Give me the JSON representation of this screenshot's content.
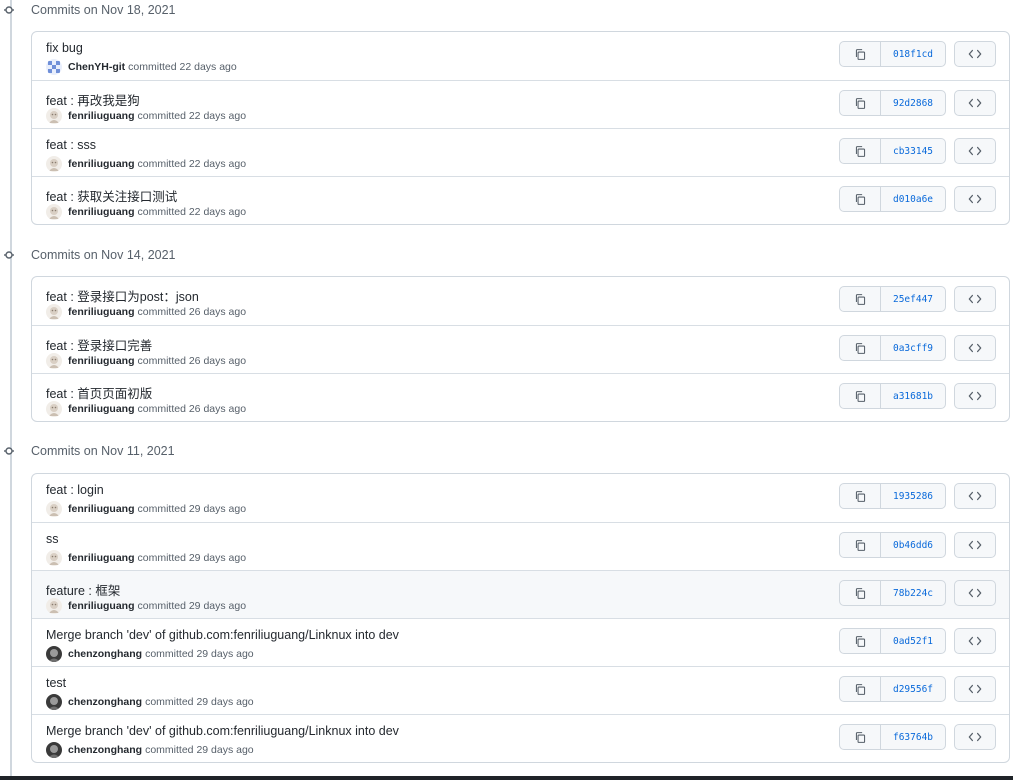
{
  "groups": [
    {
      "header": "Commits on Nov 18, 2021",
      "commits": [
        {
          "message": "fix bug",
          "author": "ChenYH-git",
          "time": "committed 22 days ago",
          "sha": "018f1cd",
          "avatar": "avatar-a"
        },
        {
          "message": "feat : 再改我是狗",
          "author": "fenriliuguang",
          "time": "committed 22 days ago",
          "sha": "92d2868",
          "avatar": "avatar-b"
        },
        {
          "message": "feat : sss",
          "author": "fenriliuguang",
          "time": "committed 22 days ago",
          "sha": "cb33145",
          "avatar": "avatar-b"
        },
        {
          "message": "feat : 获取关注接口测试",
          "author": "fenriliuguang",
          "time": "committed 22 days ago",
          "sha": "d010a6e",
          "avatar": "avatar-b"
        }
      ]
    },
    {
      "header": "Commits on Nov 14, 2021",
      "commits": [
        {
          "message": "feat : 登录接口为post：json",
          "author": "fenriliuguang",
          "time": "committed 26 days ago",
          "sha": "25ef447",
          "avatar": "avatar-b"
        },
        {
          "message": "feat : 登录接口完善",
          "author": "fenriliuguang",
          "time": "committed 26 days ago",
          "sha": "0a3cff9",
          "avatar": "avatar-b"
        },
        {
          "message": "feat : 首页页面初版",
          "author": "fenriliuguang",
          "time": "committed 26 days ago",
          "sha": "a31681b",
          "avatar": "avatar-b"
        }
      ]
    },
    {
      "header": "Commits on Nov 11, 2021",
      "commits": [
        {
          "message": "feat : login",
          "author": "fenriliuguang",
          "time": "committed 29 days ago",
          "sha": "1935286",
          "avatar": "avatar-b"
        },
        {
          "message": "ss",
          "author": "fenriliuguang",
          "time": "committed 29 days ago",
          "sha": "0b46dd6",
          "avatar": "avatar-b"
        },
        {
          "message": "feature : 框架",
          "author": "fenriliuguang",
          "time": "committed 29 days ago",
          "sha": "78b224c",
          "avatar": "avatar-b",
          "highlight": true
        },
        {
          "message": "Merge branch 'dev' of github.com:fenriliuguang/Linknux into dev",
          "author": "chenzonghang",
          "time": "committed 29 days ago",
          "sha": "0ad52f1",
          "avatar": "avatar-c"
        },
        {
          "message": "test",
          "author": "chenzonghang",
          "time": "committed 29 days ago",
          "sha": "d29556f",
          "avatar": "avatar-c"
        },
        {
          "message": "Merge branch 'dev' of github.com:fenriliuguang/Linknux into dev",
          "author": "chenzonghang",
          "time": "committed 29 days ago",
          "sha": "f63764b",
          "avatar": "avatar-c"
        }
      ]
    }
  ],
  "icons": {
    "timeline_node": "git-commit-icon",
    "copy": "copy-icon",
    "browse": "code-icon"
  },
  "colors": {
    "sha_link": "#0969da",
    "border": "#d0d7de",
    "muted_text": "#57606a"
  }
}
